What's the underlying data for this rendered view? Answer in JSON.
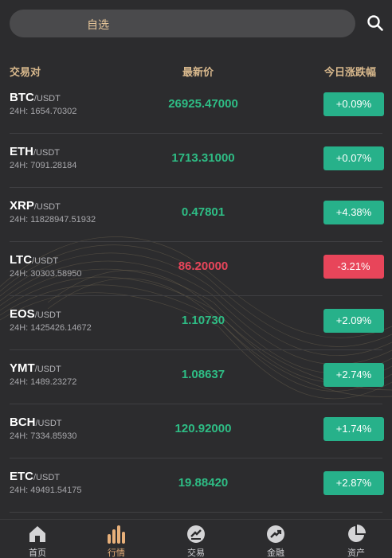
{
  "header": {
    "tab_label": "自选",
    "search_icon": "search-icon"
  },
  "columns": {
    "pair": "交易对",
    "price": "最新价",
    "change": "今日涨跌幅"
  },
  "colors": {
    "up": "#27b18a",
    "down": "#e8455a",
    "accent": "#d9b98d"
  },
  "rows": [
    {
      "base": "BTC",
      "quote": "/USDT",
      "vol": "24H: 1654.70302",
      "price": "26925.47000",
      "change": "+0.09%",
      "trend": "up"
    },
    {
      "base": "ETH",
      "quote": "/USDT",
      "vol": "24H: 7091.28184",
      "price": "1713.31000",
      "change": "+0.07%",
      "trend": "up"
    },
    {
      "base": "XRP",
      "quote": "/USDT",
      "vol": "24H: 11828947.51932",
      "price": "0.47801",
      "change": "+4.38%",
      "trend": "up"
    },
    {
      "base": "LTC",
      "quote": "/USDT",
      "vol": "24H: 30303.58950",
      "price": "86.20000",
      "change": "-3.21%",
      "trend": "down"
    },
    {
      "base": "EOS",
      "quote": "/USDT",
      "vol": "24H: 1425426.14672",
      "price": "1.10730",
      "change": "+2.09%",
      "trend": "up"
    },
    {
      "base": "YMT",
      "quote": "/USDT",
      "vol": "24H: 1489.23272",
      "price": "1.08637",
      "change": "+2.74%",
      "trend": "up"
    },
    {
      "base": "BCH",
      "quote": "/USDT",
      "vol": "24H: 7334.85930",
      "price": "120.92000",
      "change": "+1.74%",
      "trend": "up"
    },
    {
      "base": "ETC",
      "quote": "/USDT",
      "vol": "24H: 49491.54175",
      "price": "19.88420",
      "change": "+2.87%",
      "trend": "up"
    }
  ],
  "nav": [
    {
      "label": "首页",
      "icon": "home-icon",
      "active": false
    },
    {
      "label": "行情",
      "icon": "market-bars-icon",
      "active": true
    },
    {
      "label": "交易",
      "icon": "trade-icon",
      "active": false
    },
    {
      "label": "金融",
      "icon": "finance-trend-icon",
      "active": false
    },
    {
      "label": "资产",
      "icon": "assets-pie-icon",
      "active": false
    }
  ]
}
